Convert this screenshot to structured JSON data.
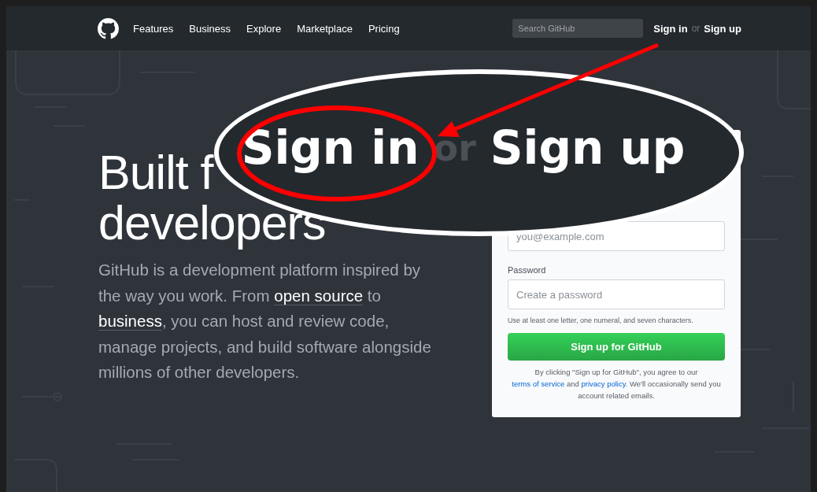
{
  "nav": {
    "links": [
      "Features",
      "Business",
      "Explore",
      "Marketplace",
      "Pricing"
    ],
    "search": {
      "placeholder": "Search GitHub"
    },
    "sign_in": "Sign in",
    "or": "or",
    "sign_up": "Sign up"
  },
  "hero": {
    "heading_lines": [
      "Built f",
      "developers"
    ],
    "intro": [
      {
        "kind": "text",
        "text": "GitHub is a development platform inspired by the way you work. From "
      },
      {
        "kind": "link",
        "text": "open source"
      },
      {
        "kind": "text",
        "text": " to "
      },
      {
        "kind": "link",
        "text": "business"
      },
      {
        "kind": "text",
        "text": ", you can host and review code, manage projects, and build software alongside millions of other developers."
      }
    ]
  },
  "signup_card": {
    "email": {
      "placeholder": "you@example.com"
    },
    "password": {
      "label": "Password",
      "placeholder": "Create a password"
    },
    "hint": "Use at least one letter, one numeral, and seven characters.",
    "button": "Sign up for GitHub",
    "legal": [
      {
        "kind": "text",
        "text": "By clicking \"Sign up for GitHub\", you agree to our "
      },
      {
        "kind": "link",
        "text": "terms of service"
      },
      {
        "kind": "text",
        "text": " and "
      },
      {
        "kind": "link",
        "text": "privacy policy"
      },
      {
        "kind": "text",
        "text": ". We'll occasionally send you account related emails."
      }
    ]
  },
  "callout": {
    "sign_in": "Sign in",
    "or": "or",
    "sign_up": "Sign up"
  }
}
